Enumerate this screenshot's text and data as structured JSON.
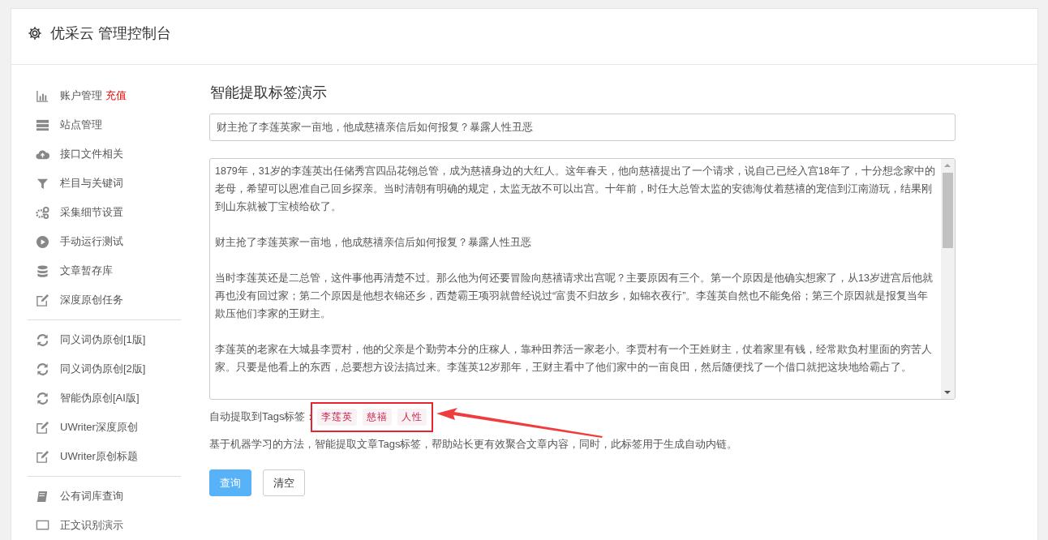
{
  "header": {
    "title": "优采云 管理控制台"
  },
  "sidebar": {
    "groups": [
      {
        "items": [
          {
            "label": "账户管理",
            "badge": "充值"
          },
          {
            "label": "站点管理"
          },
          {
            "label": "接口文件相关"
          },
          {
            "label": "栏目与关键词"
          },
          {
            "label": "采集细节设置"
          },
          {
            "label": "手动运行测试"
          },
          {
            "label": "文章暂存库"
          },
          {
            "label": "深度原创任务"
          }
        ]
      },
      {
        "items": [
          {
            "label": "同义词伪原创[1版]"
          },
          {
            "label": "同义词伪原创[2版]"
          },
          {
            "label": "智能伪原创[AI版]"
          },
          {
            "label": "UWriter深度原创"
          },
          {
            "label": "UWriter原创标题"
          }
        ]
      },
      {
        "items": [
          {
            "label": "公有词库查询"
          },
          {
            "label": "正文识别演示"
          }
        ]
      }
    ]
  },
  "main": {
    "title": "智能提取标签演示",
    "title_field": {
      "value": "财主抢了李莲英家一亩地，他成慈禧亲信后如何报复？暴露人性丑恶"
    },
    "content_field": {
      "paragraphs": [
        "1879年，31岁的李莲英出任储秀宫四品花翎总管，成为慈禧身边的大红人。这年春天，他向慈禧提出了一个请求，说自己已经入宫18年了，十分想念家中的老母，希望可以恩准自己回乡探亲。当时清朝有明确的规定，太监无故不可以出宫。十年前，时任大总管太监的安德海仗着慈禧的宠信到江南游玩，结果刚到山东就被丁宝桢给砍了。",
        "财主抢了李莲英家一亩地，他成慈禧亲信后如何报复？暴露人性丑恶",
        "当时李莲英还是二总管，这件事他再清楚不过。那么他为何还要冒险向慈禧请求出宫呢？主要原因有三个。第一个原因是他确实想家了，从13岁进宫后他就再也没有回过家；第二个原因是他想衣锦还乡，西楚霸王项羽就曾经说过“富贵不归故乡，如锦衣夜行”。李莲英自然也不能免俗；第三个原因就是报复当年欺压他们李家的王财主。",
        "李莲英的老家在大城县李贾村，他的父亲是个勤劳本分的庄稼人，靠种田养活一家老小。李贾村有一个王姓财主，仗着家里有钱，经常欺负村里面的穷苦人家。只要是他看上的东西，总要想方设法搞过来。李莲英12岁那年，王财主看中了他们家中的一亩良田，然后随便找了一个借口就把这块地给霸占了。"
      ]
    },
    "tags_label": "自动提取到Tags标签：",
    "tags": [
      "李莲英",
      "慈禧",
      "人性"
    ],
    "description": "基于机器学习的方法，智能提取文章Tags标签，帮助站长更有效聚合文章内容，同时，此标签用于生成自动内链。",
    "buttons": [
      {
        "label": "查询",
        "kind": "primary"
      },
      {
        "label": "清空",
        "kind": "default"
      }
    ]
  }
}
